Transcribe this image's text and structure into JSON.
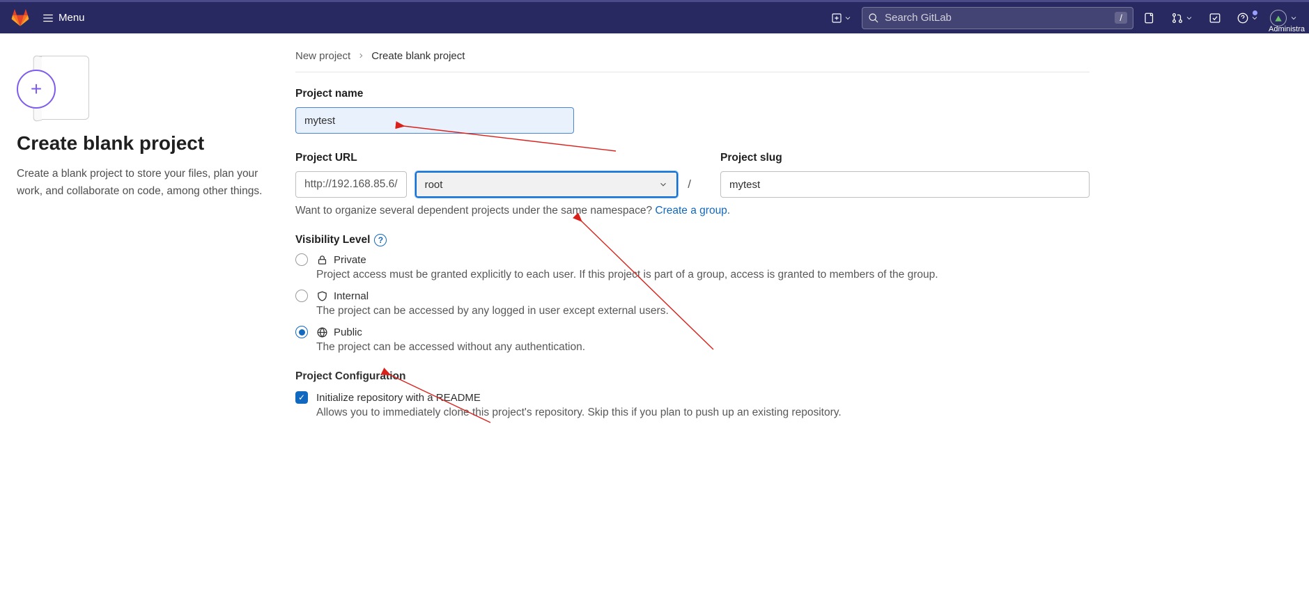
{
  "topbar": {
    "menu_label": "Menu",
    "search_placeholder": "Search GitLab",
    "kbd_hint": "/",
    "user_label": "Administra"
  },
  "sidebar": {
    "title": "Create blank project",
    "description": "Create a blank project to store your files, plan your work, and collaborate on code, among other things."
  },
  "breadcrumb": {
    "parent": "New project",
    "current": "Create blank project"
  },
  "form": {
    "name_label": "Project name",
    "name_value": "mytest",
    "url_label": "Project URL",
    "slug_label": "Project slug",
    "url_prefix": "http://192.168.85.6/",
    "namespace": "root",
    "slug_value": "mytest",
    "namespace_hint": "Want to organize several dependent projects under the same namespace? ",
    "namespace_hint_link": "Create a group.",
    "visibility_label": "Visibility Level",
    "visibility": {
      "private": {
        "label": "Private",
        "desc": "Project access must be granted explicitly to each user. If this project is part of a group, access is granted to members of the group."
      },
      "internal": {
        "label": "Internal",
        "desc": "The project can be accessed by any logged in user except external users."
      },
      "public": {
        "label": "Public",
        "desc": "The project can be accessed without any authentication."
      }
    },
    "config_label": "Project Configuration",
    "readme_label": "Initialize repository with a README",
    "readme_desc": "Allows you to immediately clone this project's repository. Skip this if you plan to push up an existing repository."
  }
}
